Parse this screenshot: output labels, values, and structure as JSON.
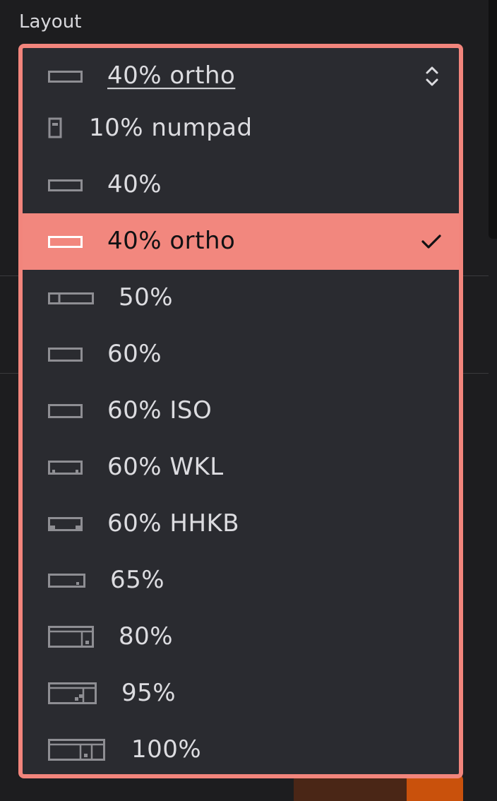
{
  "section": {
    "label": "Layout"
  },
  "dropdown": {
    "current_value": "40% ortho",
    "selected_value": "40% ortho",
    "options": [
      {
        "label": "10% numpad",
        "icon": "keyboard-numpad-icon"
      },
      {
        "label": "40%",
        "icon": "keyboard-40-icon"
      },
      {
        "label": "40% ortho",
        "icon": "keyboard-40-ortho-icon"
      },
      {
        "label": "50%",
        "icon": "keyboard-50-icon"
      },
      {
        "label": "60%",
        "icon": "keyboard-60-icon"
      },
      {
        "label": "60% ISO",
        "icon": "keyboard-60-iso-icon"
      },
      {
        "label": "60% WKL",
        "icon": "keyboard-60-wkl-icon"
      },
      {
        "label": "60% HHKB",
        "icon": "keyboard-60-hhkb-icon"
      },
      {
        "label": "65%",
        "icon": "keyboard-65-icon"
      },
      {
        "label": "80%",
        "icon": "keyboard-80-icon"
      },
      {
        "label": "95%",
        "icon": "keyboard-95-icon"
      },
      {
        "label": "100%",
        "icon": "keyboard-100-icon"
      }
    ]
  },
  "colors": {
    "accent": "#f2877e",
    "popup_bg": "#2a2b30",
    "page_bg": "#1d1d1f"
  }
}
